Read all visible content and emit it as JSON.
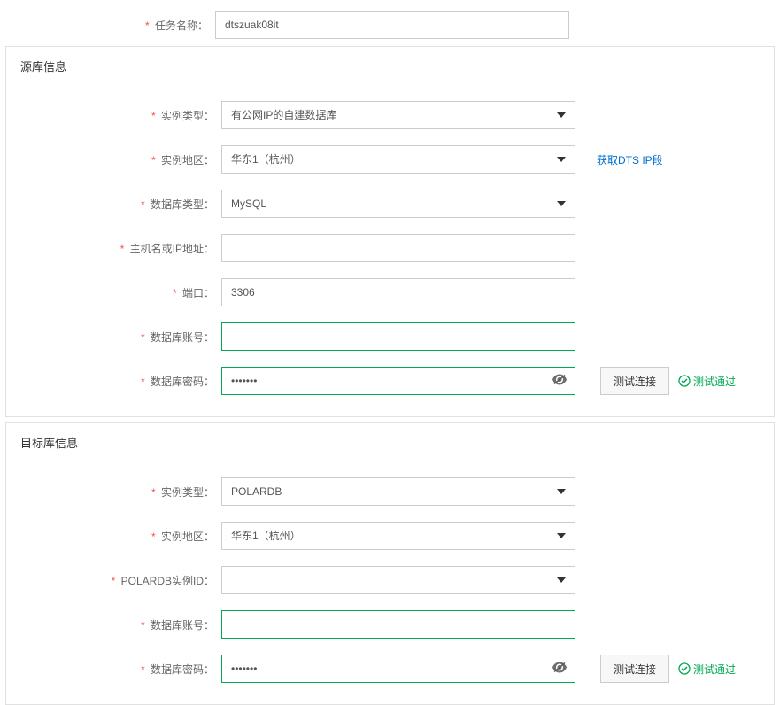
{
  "top": {
    "task_name_label": "任务名称：",
    "task_name_value": "dtszuak08it"
  },
  "source": {
    "section_title": "源库信息",
    "instance_type_label": "实例类型：",
    "instance_type_value": "有公网IP的自建数据库",
    "instance_region_label": "实例地区：",
    "instance_region_value": "华东1（杭州）",
    "dts_ip_link": "获取DTS IP段",
    "db_type_label": "数据库类型：",
    "db_type_value": "MySQL",
    "host_label": "主机名或IP地址：",
    "host_value": "",
    "port_label": "端口：",
    "port_value": "3306",
    "db_account_label": "数据库账号：",
    "db_account_value": "",
    "db_password_label": "数据库密码：",
    "db_password_value": "•••••••",
    "test_button": "测试连接",
    "test_status": "测试通过"
  },
  "target": {
    "section_title": "目标库信息",
    "instance_type_label": "实例类型：",
    "instance_type_value": "POLARDB",
    "instance_region_label": "实例地区：",
    "instance_region_value": "华东1（杭州）",
    "polardb_id_label": "POLARDB实例ID：",
    "polardb_id_value": "",
    "db_account_label": "数据库账号：",
    "db_account_value": "",
    "db_password_label": "数据库密码：",
    "db_password_value": "•••••••",
    "test_button": "测试连接",
    "test_status": "测试通过"
  }
}
